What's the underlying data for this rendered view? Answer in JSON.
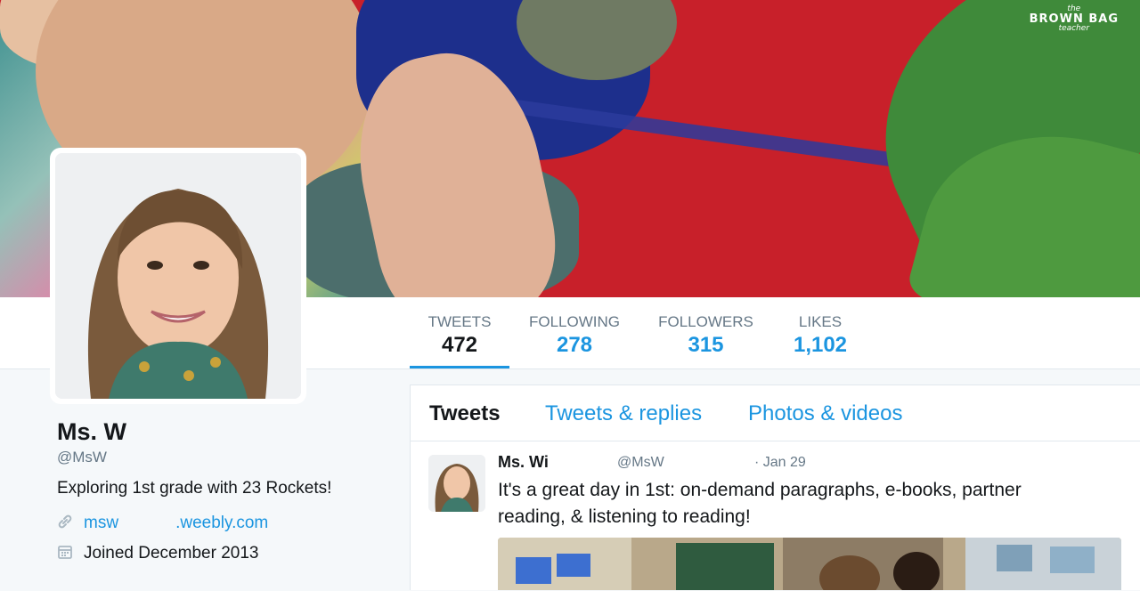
{
  "brand": {
    "line1": "the",
    "line2": "BROWN BAG",
    "line3": "teacher"
  },
  "profile": {
    "name": "Ms. W",
    "handle": "@MsW",
    "bio": "Exploring 1st grade with 23 Rockets!",
    "url_prefix": "msw",
    "url_suffix": ".weebly.com",
    "joined": "Joined December 2013"
  },
  "stats": [
    {
      "label": "TWEETS",
      "value": "472"
    },
    {
      "label": "FOLLOWING",
      "value": "278"
    },
    {
      "label": "FOLLOWERS",
      "value": "315"
    },
    {
      "label": "LIKES",
      "value": "1,102"
    }
  ],
  "tabs": [
    {
      "label": "Tweets"
    },
    {
      "label": "Tweets & replies"
    },
    {
      "label": "Photos & videos"
    }
  ],
  "tweet": {
    "name": "Ms. Wi",
    "handle": "@MsW",
    "date": "· Jan 29",
    "text": "It's a great day in 1st: on-demand paragraphs, e-books, partner reading, & listening to reading!"
  },
  "colors": {
    "accent": "#1b95e0",
    "text": "#14171a",
    "muted": "#657786",
    "background": "#f5f8fa"
  }
}
